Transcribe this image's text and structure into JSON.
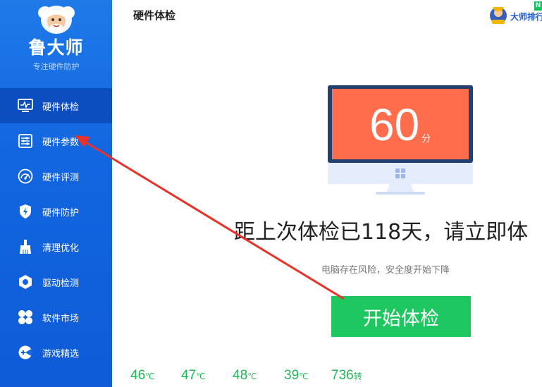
{
  "brand": {
    "name": "鲁大师",
    "slogan": "专注硬件防护"
  },
  "header": {
    "title": "硬件体检",
    "rank_label": "大师排行",
    "new_tag": "N"
  },
  "sidebar": {
    "items": [
      {
        "label": "硬件体检",
        "icon": "monitor-pulse-icon",
        "active": true
      },
      {
        "label": "硬件参数",
        "icon": "sliders-icon",
        "active": false
      },
      {
        "label": "硬件评测",
        "icon": "gauge-icon",
        "active": false
      },
      {
        "label": "硬件防护",
        "icon": "shield-bolt-icon",
        "active": false
      },
      {
        "label": "清理优化",
        "icon": "broom-icon",
        "active": false
      },
      {
        "label": "驱动检测",
        "icon": "hexagon-gear-icon",
        "active": false
      },
      {
        "label": "软件市场",
        "icon": "clover-icon",
        "active": false
      },
      {
        "label": "游戏精选",
        "icon": "gamepad-icon",
        "active": false
      }
    ]
  },
  "main": {
    "score": {
      "value": "60",
      "unit": "分"
    },
    "headline": "距上次体检已118天，请立即体",
    "subline": "电脑存在风险，安全度开始下降",
    "start_button": "开始体检"
  },
  "stats": [
    {
      "value": "46",
      "unit": "℃"
    },
    {
      "value": "47",
      "unit": "℃"
    },
    {
      "value": "48",
      "unit": "℃"
    },
    {
      "value": "39",
      "unit": "℃"
    },
    {
      "value": "736",
      "unit": "转"
    }
  ],
  "colors": {
    "sidebar": "#1266e0",
    "sidebar_active": "#0c4dbf",
    "score_screen": "#ff6d4d",
    "monitor_frame": "#24406e",
    "start_button": "#1fc760",
    "stat_text": "#1db955",
    "annotation_arrow": "#e8322a"
  }
}
